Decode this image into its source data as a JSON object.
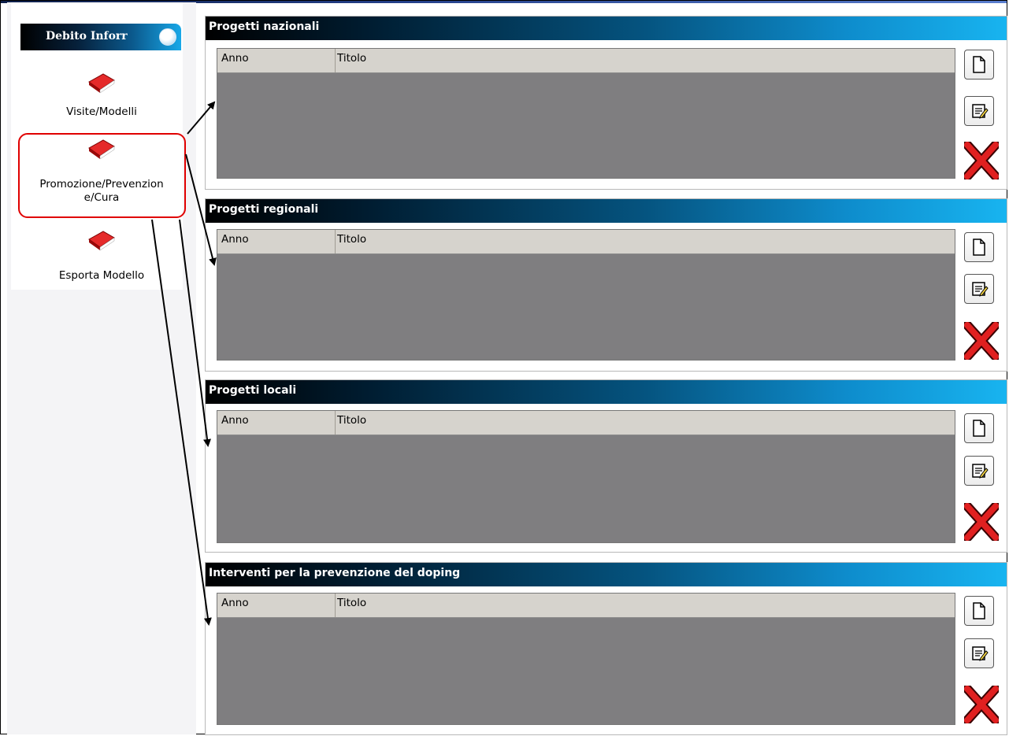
{
  "sidebar": {
    "header": "Debito Inforr",
    "items": [
      {
        "label": "Visite/Modelli",
        "icon": "book-icon"
      },
      {
        "label_line1": "Promozione/Prevenzion",
        "label_line2": "e/Cura",
        "icon": "book-icon",
        "selected": true
      },
      {
        "label": "Esporta Modello",
        "icon": "book-icon"
      }
    ]
  },
  "panels": [
    {
      "title": "Progetti nazionali",
      "columns": [
        "Anno",
        "Titolo"
      ],
      "rows": []
    },
    {
      "title": "Progetti regionali",
      "columns": [
        "Anno",
        "Titolo"
      ],
      "rows": []
    },
    {
      "title": "Progetti locali",
      "columns": [
        "Anno",
        "Titolo"
      ],
      "rows": []
    },
    {
      "title": "Interventi per  la prevenzione del doping",
      "columns": [
        "Anno",
        "Titolo"
      ],
      "rows": []
    }
  ],
  "icons": {
    "new": "new-document-icon",
    "edit": "edit-document-icon",
    "delete": "delete-x-icon"
  },
  "colors": {
    "header_gradient_start": "#000000",
    "header_gradient_end": "#18b4f0",
    "grid_body": "#7f7e80",
    "grid_header": "#d6d3cd",
    "highlight": "#e00000",
    "book": "#c8101c"
  }
}
